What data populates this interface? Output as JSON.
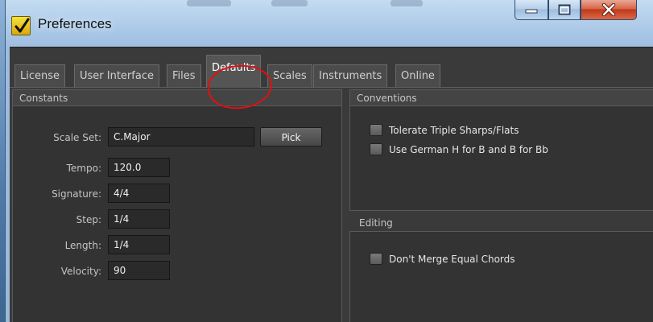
{
  "window": {
    "title": "Preferences",
    "app_icon": "checkmark-pen-icon",
    "controls": {
      "minimize": "minimize-icon",
      "maximize": "maximize-icon",
      "close": "close-icon"
    }
  },
  "tabs": [
    {
      "label": "License"
    },
    {
      "label": "User Interface"
    },
    {
      "label": "Files"
    },
    {
      "label": "Defaults",
      "active": true
    },
    {
      "label": "Scales"
    },
    {
      "label": "Instruments"
    },
    {
      "label": "Online"
    }
  ],
  "constants": {
    "header": "Constants",
    "scale_set": {
      "label": "Scale Set:",
      "value": "C.Major",
      "button": "Pick"
    },
    "tempo": {
      "label": "Tempo:",
      "value": "120.0"
    },
    "signature": {
      "label": "Signature:",
      "value": "4/4"
    },
    "step": {
      "label": "Step:",
      "value": "1/4"
    },
    "length": {
      "label": "Length:",
      "value": "1/4"
    },
    "velocity": {
      "label": "Velocity:",
      "value": "90"
    }
  },
  "conventions": {
    "header": "Conventions",
    "options": [
      {
        "label": "Tolerate Triple Sharps/Flats",
        "checked": false
      },
      {
        "label": "Use German H for B and B for Bb",
        "checked": false
      }
    ]
  },
  "editing": {
    "header": "Editing",
    "options": [
      {
        "label": "Don't Merge Equal Chords",
        "checked": false
      }
    ]
  },
  "colors": {
    "panel": "#333333",
    "annotation_circle": "#e01010",
    "close_button": "#c2391a"
  }
}
